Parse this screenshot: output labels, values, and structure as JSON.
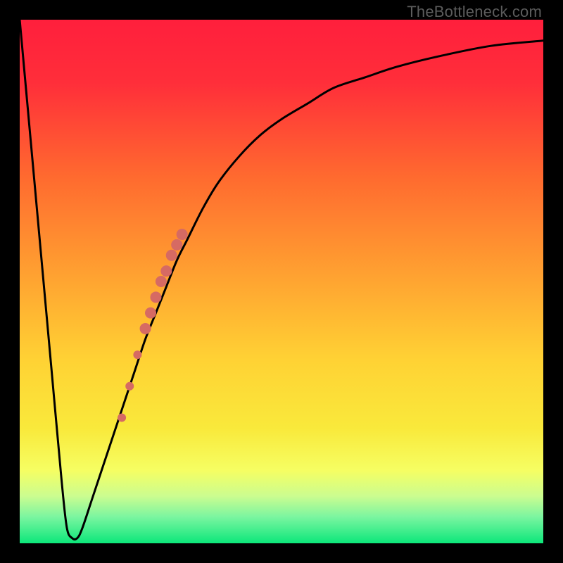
{
  "watermark": "TheBottleneck.com",
  "colors": {
    "frame": "#000000",
    "curve": "#000000",
    "dots": "#D66A63",
    "gradient_stops": [
      {
        "offset": 0.0,
        "color": "#FF1F3C"
      },
      {
        "offset": 0.12,
        "color": "#FF2E3A"
      },
      {
        "offset": 0.3,
        "color": "#FF6A2F"
      },
      {
        "offset": 0.5,
        "color": "#FFA531"
      },
      {
        "offset": 0.65,
        "color": "#FFD234"
      },
      {
        "offset": 0.78,
        "color": "#F9E93B"
      },
      {
        "offset": 0.86,
        "color": "#F6FE62"
      },
      {
        "offset": 0.91,
        "color": "#CBFD90"
      },
      {
        "offset": 0.95,
        "color": "#7AF5A0"
      },
      {
        "offset": 1.0,
        "color": "#0CE77A"
      }
    ]
  },
  "chart_data": {
    "type": "line",
    "title": "",
    "xlabel": "",
    "ylabel": "",
    "xlim": [
      0,
      100
    ],
    "ylim": [
      0,
      100
    ],
    "grid": false,
    "legend": false,
    "series": [
      {
        "name": "bottleneck-curve",
        "x": [
          0,
          2,
          4,
          6,
          8,
          9,
          10,
          11,
          12,
          14,
          16,
          18,
          20,
          22,
          24,
          26,
          28,
          30,
          32,
          35,
          38,
          42,
          46,
          50,
          55,
          60,
          66,
          72,
          80,
          90,
          100
        ],
        "y": [
          100,
          78,
          56,
          34,
          12,
          3,
          1,
          1,
          3,
          9,
          15,
          21,
          27,
          33,
          39,
          44,
          49,
          54,
          58,
          64,
          69,
          74,
          78,
          81,
          84,
          87,
          89,
          91,
          93,
          95,
          96
        ]
      }
    ],
    "highlight_points": {
      "name": "highlighted-segment",
      "color": "#D66A63",
      "points": [
        {
          "x": 19.5,
          "y": 24,
          "r": 6
        },
        {
          "x": 21.0,
          "y": 30,
          "r": 6
        },
        {
          "x": 22.5,
          "y": 36,
          "r": 6
        },
        {
          "x": 24.0,
          "y": 41,
          "r": 8
        },
        {
          "x": 25.0,
          "y": 44,
          "r": 8
        },
        {
          "x": 26.0,
          "y": 47,
          "r": 8
        },
        {
          "x": 27.0,
          "y": 50,
          "r": 8
        },
        {
          "x": 28.0,
          "y": 52,
          "r": 8
        },
        {
          "x": 29.0,
          "y": 55,
          "r": 8
        },
        {
          "x": 30.0,
          "y": 57,
          "r": 8
        },
        {
          "x": 31.0,
          "y": 59,
          "r": 8
        }
      ]
    }
  }
}
